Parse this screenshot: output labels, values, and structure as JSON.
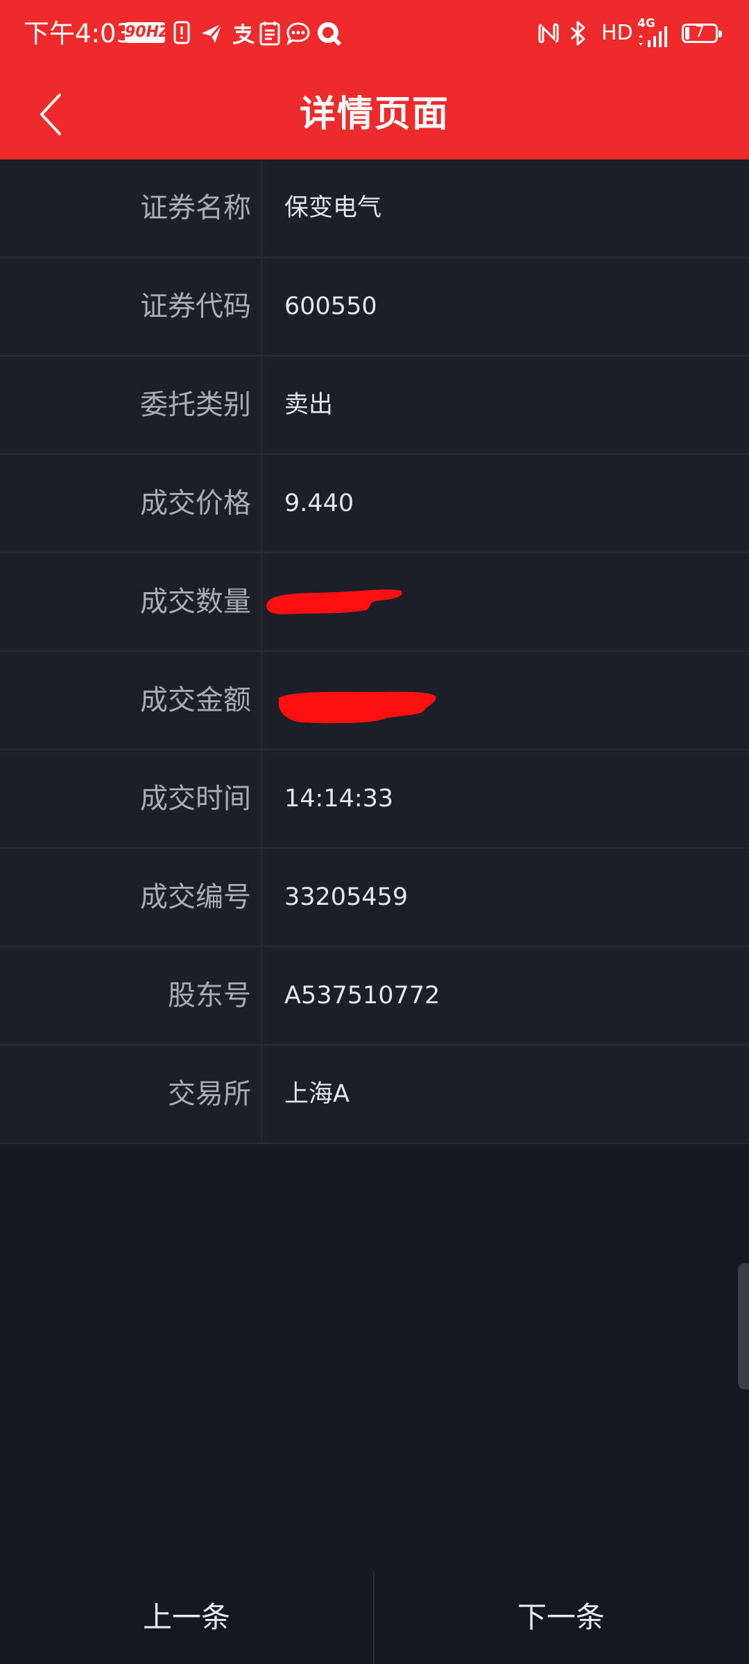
{
  "status_bar": {
    "time": "下午4:03",
    "refresh_rate": "90HZ",
    "signal_text": "HD",
    "network_type": "4G",
    "battery_level": "7",
    "icons": [
      "warning-icon",
      "paper-plane-icon",
      "alipay-icon",
      "notepad-icon",
      "chat-icon",
      "q-app-icon",
      "nfc-icon",
      "bluetooth-icon",
      "signal-icon",
      "battery-icon"
    ]
  },
  "header": {
    "title": "详情页面",
    "back_icon": "chevron-left-icon"
  },
  "details": [
    {
      "label": "证券名称",
      "value": "保变电气"
    },
    {
      "label": "证券代码",
      "value": "600550"
    },
    {
      "label": "委托类别",
      "value": "卖出"
    },
    {
      "label": "成交价格",
      "value": "9.440"
    },
    {
      "label": "成交数量",
      "value": ""
    },
    {
      "label": "成交金额",
      "value": ""
    },
    {
      "label": "成交时间",
      "value": "14:14:33"
    },
    {
      "label": "成交编号",
      "value": "33205459"
    },
    {
      "label": "股东号",
      "value": "A537510772"
    },
    {
      "label": "交易所",
      "value": "上海A"
    }
  ],
  "footer": {
    "prev_label": "上一条",
    "next_label": "下一条"
  },
  "colors": {
    "accent": "#ef2a2a",
    "background": "#141820",
    "row_background": "#1b1f27",
    "redaction": "#ff1010"
  }
}
